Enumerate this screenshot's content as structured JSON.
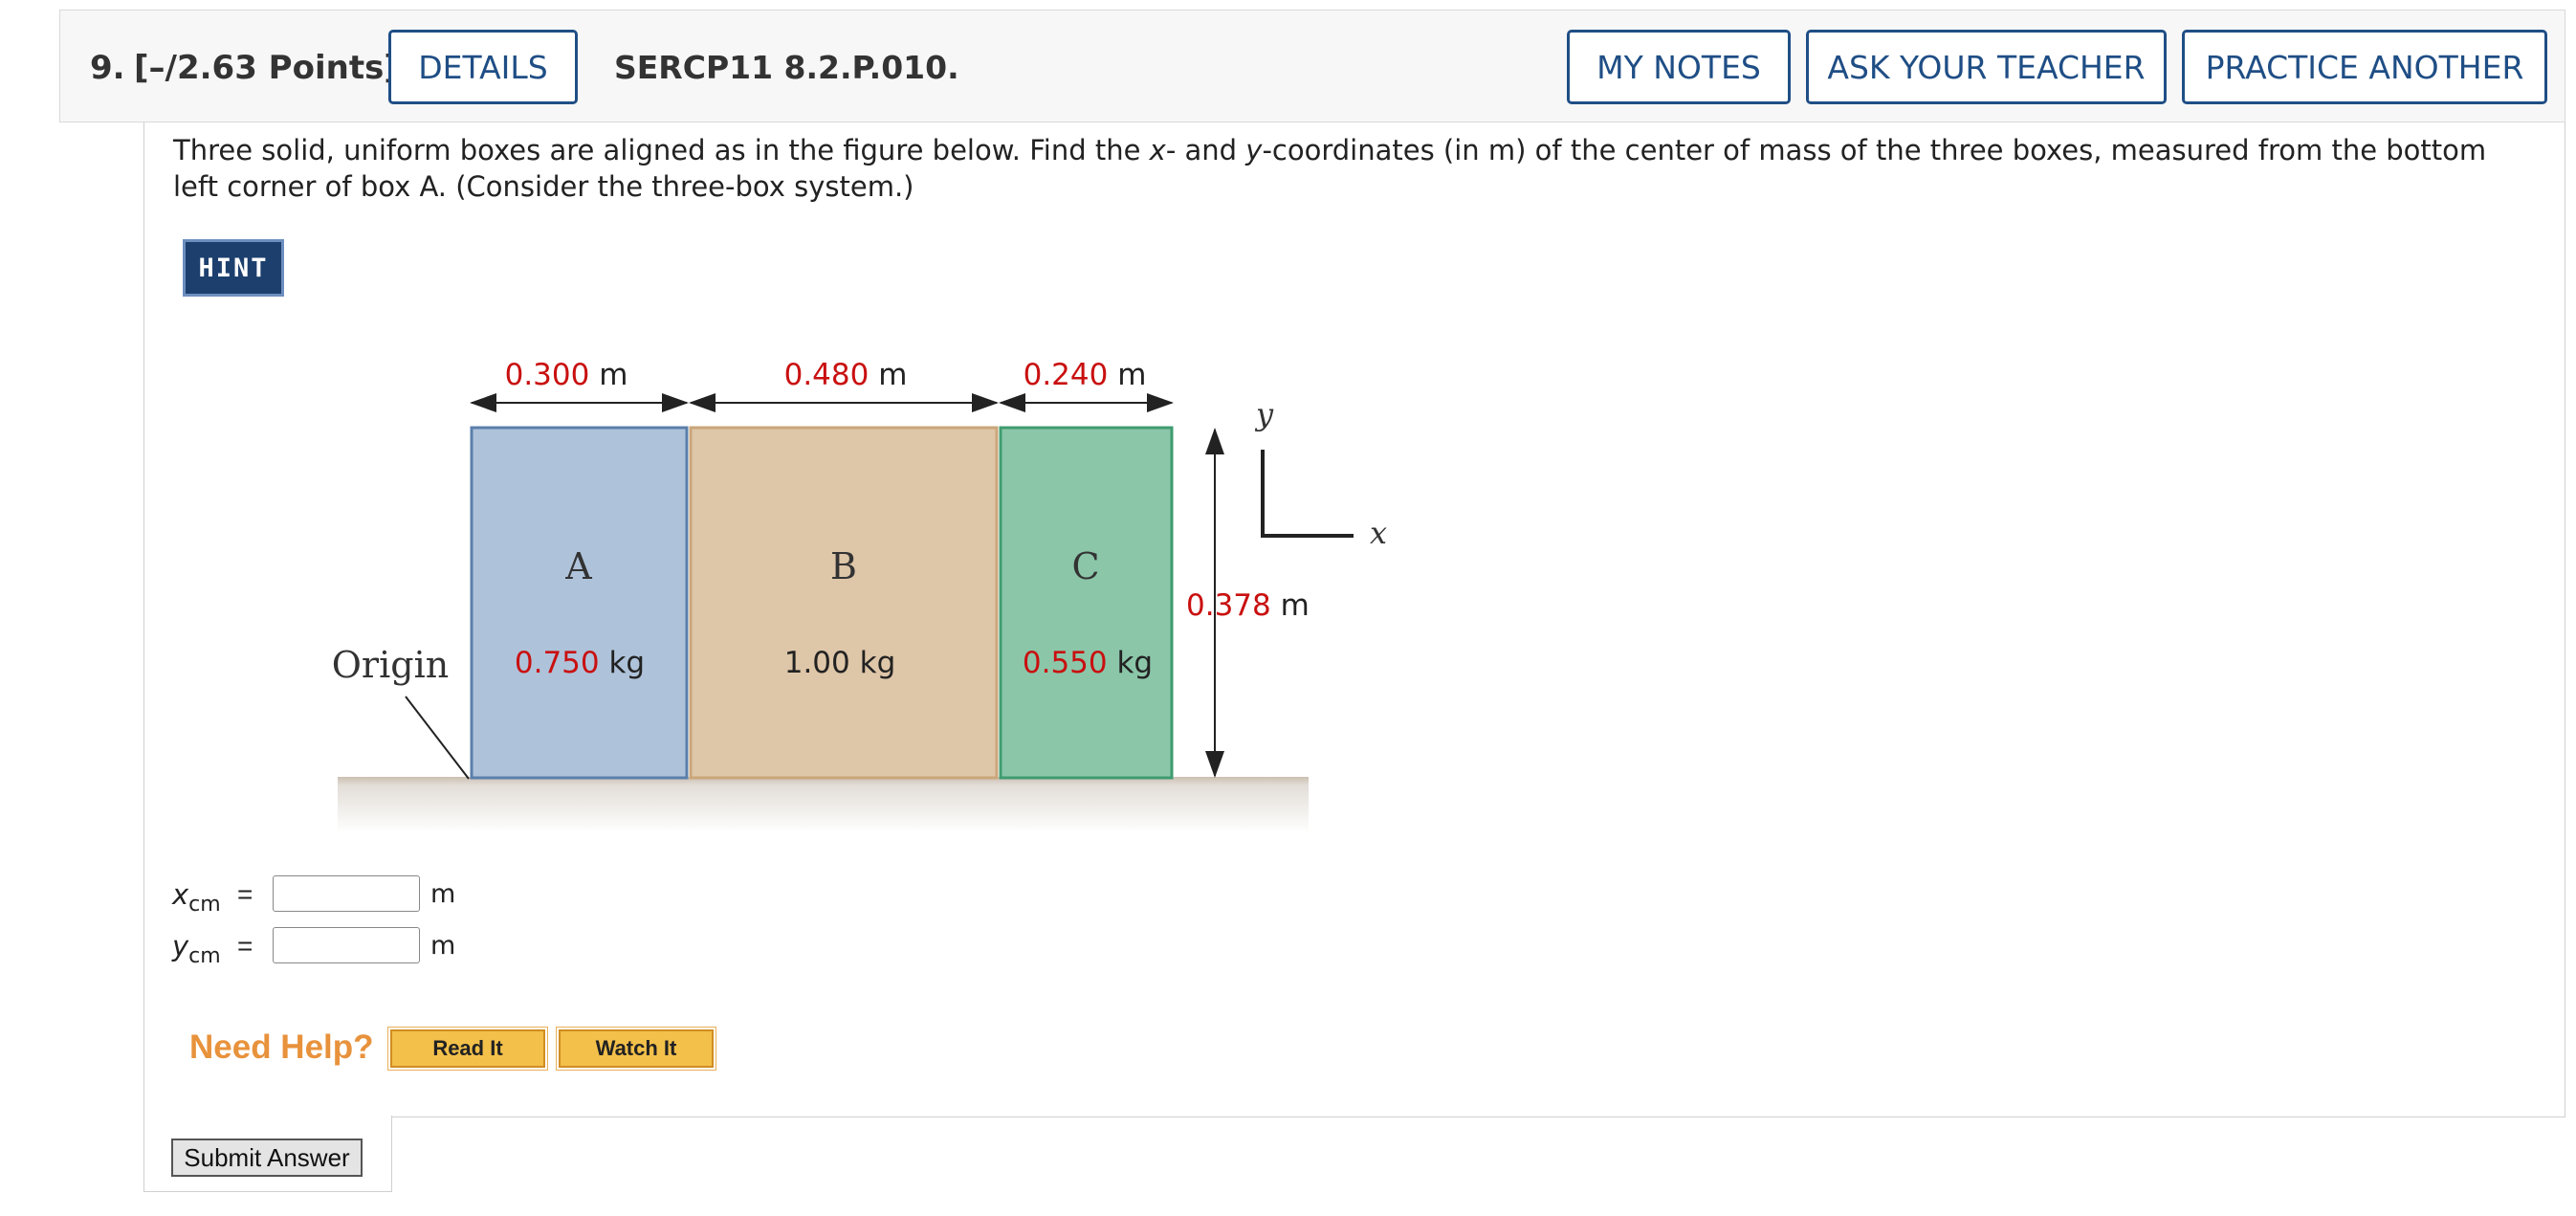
{
  "header": {
    "number": "9.",
    "points": "[–/2.63 Points]",
    "details_label": "DETAILS",
    "code": "SERCP11 8.2.P.010.",
    "my_notes_label": "MY NOTES",
    "ask_teacher_label": "ASK YOUR TEACHER",
    "practice_label": "PRACTICE ANOTHER"
  },
  "question": {
    "part1": "Three solid, uniform boxes are aligned as in the figure below. Find the ",
    "x": "x",
    "part2": "- and ",
    "y": "y",
    "part3": "-coordinates (in m) of the center of mass of the three boxes, measured from the bottom left corner of box A. (Consider the three-box system.)"
  },
  "hint_label": "HINT",
  "figure": {
    "widths": [
      {
        "value": "0.300",
        "unit": " m"
      },
      {
        "value": "0.480",
        "unit": " m"
      },
      {
        "value": "0.240",
        "unit": " m"
      }
    ],
    "height": {
      "value": "0.378",
      "unit": " m"
    },
    "boxes": [
      {
        "label": "A",
        "mass_value": "0.750",
        "mass_unit": " kg",
        "color": "#aec3da"
      },
      {
        "label": "B",
        "mass_text": "1.00 kg",
        "color": "#dec6a8"
      },
      {
        "label": "C",
        "mass_value": "0.550",
        "mass_unit": " kg",
        "color": "#8bc6a9"
      }
    ],
    "origin_label": "Origin",
    "axis_x": "x",
    "axis_y": "y",
    "value_color": "#c91010"
  },
  "answers": {
    "x_var": "x",
    "x_sub": "cm",
    "y_var": "y",
    "y_sub": "cm",
    "equals": "=",
    "unit": "m"
  },
  "help": {
    "need_help": "Need Help?",
    "read_it": "Read It",
    "watch_it": "Watch It"
  },
  "submit_label": "Submit Answer"
}
